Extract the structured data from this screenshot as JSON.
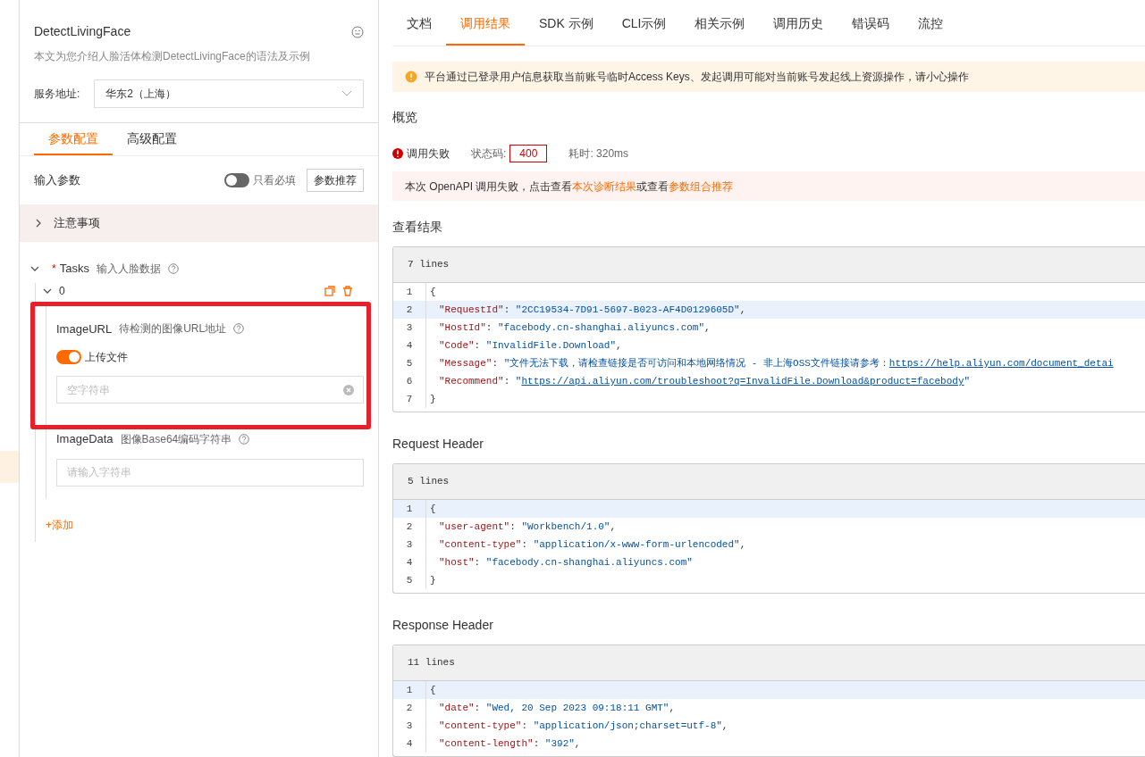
{
  "api": {
    "title": "DetectLivingFace",
    "description": "本文为您介绍人脸活体检测DetectLivingFace的语法及示例"
  },
  "service_address": {
    "label": "服务地址:",
    "value": "华东2（上海）"
  },
  "config_tabs": [
    {
      "label": "参数配置",
      "selected": true
    },
    {
      "label": "高级配置",
      "selected": false
    }
  ],
  "input_params": {
    "title": "输入参数",
    "required_only": {
      "label": "只看必填",
      "on": false
    },
    "recommend_button": "参数推荐"
  },
  "notes_section": {
    "label": "注意事项",
    "expanded": false
  },
  "tasks": {
    "name": "Tasks",
    "required_mark": "*",
    "description": "输入人脸数据",
    "expanded": true,
    "items": [
      {
        "label": "0",
        "expanded": true,
        "fields": [
          {
            "name": "ImageURL",
            "description": "待检测的图像URL地址",
            "upload": {
              "label": "上传文件",
              "on": true
            },
            "input": {
              "placeholder": "空字符串",
              "clearable": true
            }
          },
          {
            "name": "ImageData",
            "description": "图像Base64编码字符串",
            "input": {
              "placeholder": "请输入字符串",
              "clearable": false
            }
          }
        ]
      }
    ],
    "add_label": "+添加"
  },
  "result_tabs": [
    {
      "label": "文档",
      "selected": false
    },
    {
      "label": "调用结果",
      "selected": true
    },
    {
      "label": "SDK 示例",
      "selected": false
    },
    {
      "label": "CLI示例",
      "selected": false
    },
    {
      "label": "相关示例",
      "selected": false
    },
    {
      "label": "调用历史",
      "selected": false
    },
    {
      "label": "错误码",
      "selected": false
    },
    {
      "label": "流控",
      "selected": false
    }
  ],
  "warning": "平台通过已登录用户信息获取当前账号临时Access Keys、发起调用可能对当前账号发起线上资源操作，请小心操作",
  "overview": {
    "heading": "概览",
    "status": "调用失败",
    "status_code_label": "状态码:",
    "status_code": "400",
    "elapsed": "耗时: 320ms"
  },
  "diagnosis": [
    {
      "kind": "text",
      "text": "本次 OpenAPI 调用失败，点击查看"
    },
    {
      "kind": "link",
      "text": "本次诊断结果"
    },
    {
      "kind": "text",
      "text": "或查看"
    },
    {
      "kind": "link",
      "text": "参数组合推荐"
    }
  ],
  "sections": [
    {
      "heading": "查看结果",
      "line_count": "7 lines",
      "lines": [
        {
          "number": "1",
          "highlighted": false,
          "parts": [
            {
              "kind": "punct",
              "text": "{"
            }
          ]
        },
        {
          "number": "2",
          "highlighted": true,
          "parts": [
            {
              "kind": "key",
              "text": "\"RequestId\""
            },
            {
              "kind": "punct",
              "text": ": "
            },
            {
              "kind": "string",
              "text": "\"2CC19534-7D91-5697-B023-AF4D0129605D\""
            },
            {
              "kind": "punct",
              "text": ","
            }
          ]
        },
        {
          "number": "3",
          "highlighted": false,
          "parts": [
            {
              "kind": "key",
              "text": "\"HostId\""
            },
            {
              "kind": "punct",
              "text": ": "
            },
            {
              "kind": "string",
              "text": "\"facebody.cn-shanghai.aliyuncs.com\""
            },
            {
              "kind": "punct",
              "text": ","
            }
          ]
        },
        {
          "number": "4",
          "highlighted": false,
          "parts": [
            {
              "kind": "key",
              "text": "\"Code\""
            },
            {
              "kind": "punct",
              "text": ": "
            },
            {
              "kind": "string",
              "text": "\"InvalidFile.Download\""
            },
            {
              "kind": "punct",
              "text": ","
            }
          ]
        },
        {
          "number": "5",
          "highlighted": false,
          "parts": [
            {
              "kind": "key",
              "text": "\"Message\""
            },
            {
              "kind": "punct",
              "text": ": "
            },
            {
              "kind": "string",
              "text": "\"文件无法下载，请检查链接是否可访问和本地网络情况 - 非上海OSS文件链接请参考："
            },
            {
              "kind": "link",
              "text": "https://help.aliyun.com/document_detai"
            }
          ]
        },
        {
          "number": "6",
          "highlighted": false,
          "parts": [
            {
              "kind": "key",
              "text": "\"Recommend\""
            },
            {
              "kind": "punct",
              "text": ": "
            },
            {
              "kind": "string",
              "text": "\""
            },
            {
              "kind": "link",
              "text": "https://api.aliyun.com/troubleshoot?q=InvalidFile.Download&product=facebody"
            },
            {
              "kind": "string",
              "text": "\""
            }
          ]
        },
        {
          "number": "7",
          "highlighted": false,
          "parts": [
            {
              "kind": "punct",
              "text": "}"
            }
          ]
        }
      ]
    },
    {
      "heading": "Request Header",
      "line_count": "5 lines",
      "lines": [
        {
          "number": "1",
          "highlighted": true,
          "parts": [
            {
              "kind": "punct",
              "text": "{"
            }
          ]
        },
        {
          "number": "2",
          "highlighted": false,
          "parts": [
            {
              "kind": "key",
              "text": "\"user-agent\""
            },
            {
              "kind": "punct",
              "text": ": "
            },
            {
              "kind": "string",
              "text": "\"Workbench/1.0\""
            },
            {
              "kind": "punct",
              "text": ","
            }
          ]
        },
        {
          "number": "3",
          "highlighted": false,
          "parts": [
            {
              "kind": "key",
              "text": "\"content-type\""
            },
            {
              "kind": "punct",
              "text": ": "
            },
            {
              "kind": "string",
              "text": "\"application/x-www-form-urlencoded\""
            },
            {
              "kind": "punct",
              "text": ","
            }
          ]
        },
        {
          "number": "4",
          "highlighted": false,
          "parts": [
            {
              "kind": "key",
              "text": "\"host\""
            },
            {
              "kind": "punct",
              "text": ": "
            },
            {
              "kind": "string",
              "text": "\"facebody.cn-shanghai.aliyuncs.com\""
            }
          ]
        },
        {
          "number": "5",
          "highlighted": false,
          "parts": [
            {
              "kind": "punct",
              "text": "}"
            }
          ]
        }
      ]
    },
    {
      "heading": "Response Header",
      "line_count": "11 lines",
      "lines": [
        {
          "number": "1",
          "highlighted": true,
          "parts": [
            {
              "kind": "punct",
              "text": "{"
            }
          ]
        },
        {
          "number": "2",
          "highlighted": false,
          "parts": [
            {
              "kind": "key",
              "text": "\"date\""
            },
            {
              "kind": "punct",
              "text": ": "
            },
            {
              "kind": "string",
              "text": "\"Wed, 20 Sep 2023 09:18:11 GMT\""
            },
            {
              "kind": "punct",
              "text": ","
            }
          ]
        },
        {
          "number": "3",
          "highlighted": false,
          "parts": [
            {
              "kind": "key",
              "text": "\"content-type\""
            },
            {
              "kind": "punct",
              "text": ": "
            },
            {
              "kind": "string",
              "text": "\"application/json;charset=utf-8\""
            },
            {
              "kind": "punct",
              "text": ","
            }
          ]
        },
        {
          "number": "4",
          "highlighted": false,
          "parts": [
            {
              "kind": "key",
              "text": "\"content-length\""
            },
            {
              "kind": "punct",
              "text": ": "
            },
            {
              "kind": "string",
              "text": "\"392\""
            },
            {
              "kind": "punct",
              "text": ","
            }
          ]
        }
      ]
    }
  ]
}
